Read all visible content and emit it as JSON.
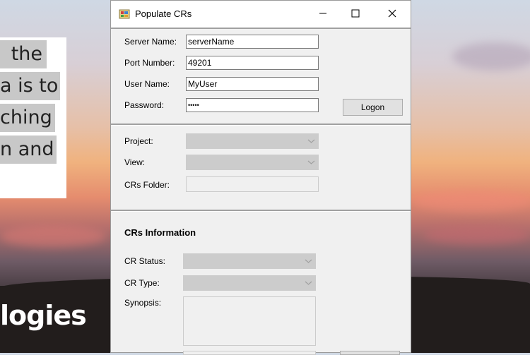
{
  "background_doc": {
    "lines": [
      "the",
      "a is to",
      "ching",
      "n and"
    ],
    "big_word": "logies"
  },
  "dialog": {
    "title": "Populate CRs",
    "window_controls": {
      "minimize": "minimize-icon",
      "maximize": "maximize-icon",
      "close": "close-icon"
    },
    "login": {
      "server_label": "Server Name:",
      "server_value": "serverName",
      "port_label": "Port Number:",
      "port_value": "49201",
      "user_label": "User Name:",
      "user_value": "MyUser",
      "password_label": "Password:",
      "password_value": "•••••",
      "logon_label": "Logon"
    },
    "project": {
      "project_label": "Project:",
      "view_label": "View:",
      "folder_label": "CRs Folder:"
    },
    "crs_info": {
      "title": "CRs Information",
      "status_label": "CR Status:",
      "type_label": "CR Type:",
      "synopsis_label": "Synopsis:"
    }
  }
}
